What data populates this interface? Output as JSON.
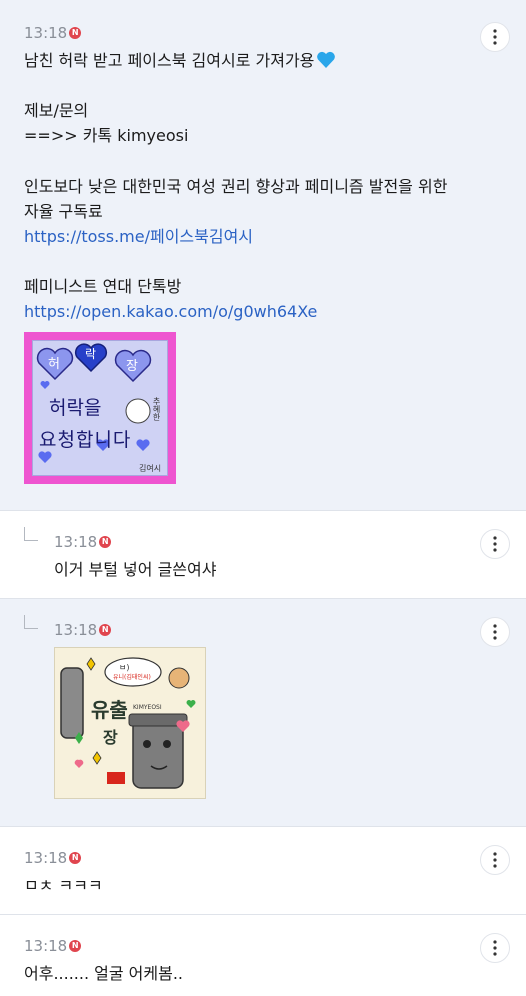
{
  "post": {
    "time": "13:18",
    "badge": "N",
    "line1": "남친 허락 받고 페이스북 김여시로 가져가용",
    "line2": "제보/문의",
    "line3": "==>> 카톡 kimyeosi",
    "line4": "인도보다 낮은 대한민국 여성 권리 향상과 페미니즘 발전을 위한",
    "line5": "자율 구독료",
    "link1": "https://toss.me/페이스북김여시",
    "line6": "페미니스트 연대 단톡방",
    "link2": "https://open.kakao.com/o/g0wh64Xe",
    "image_text": {
      "hearts": [
        "허",
        "락",
        "장"
      ],
      "line_a": "허락을",
      "line_b": "요청합니다",
      "side": "추혜한",
      "sign": "김여시"
    }
  },
  "comments": [
    {
      "time": "13:18",
      "badge": "N",
      "text": "이거 부털 넣어 글쓴여샤"
    },
    {
      "time": "13:18",
      "badge": "N",
      "image_text": {
        "bubble": "ㅂ)",
        "bubble2": "유니(김태인씨)",
        "big1": "유출",
        "big2": "장",
        "tag": "KIMYEOSI"
      }
    },
    {
      "time": "13:18",
      "badge": "N",
      "text": "ㅁㅊ ㅋㅋㅋ"
    },
    {
      "time": "13:18",
      "badge": "N",
      "text": "어후....... 얼굴 어케봄.."
    }
  ],
  "colors": {
    "accent_link": "#2b62c4",
    "badge": "#e0454e",
    "post_bg": "#eef2f9"
  }
}
